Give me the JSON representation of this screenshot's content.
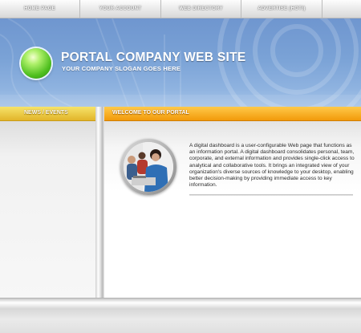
{
  "nav": {
    "items": [
      {
        "label": "HOME PAGE"
      },
      {
        "label": "YOUR ACCOUNT"
      },
      {
        "label": "WEB DIRECTORY"
      },
      {
        "label": "ADVERTISE (HOT!)"
      }
    ]
  },
  "header": {
    "title": "PORTAL COMPANY WEB SITE",
    "slogan": "YOUR COMPANY SLOGAN GOES HERE"
  },
  "sidebar": {
    "heading": "NEWS / EVENTS"
  },
  "main": {
    "heading": "WELCOME TO OUR PORTAL",
    "intro": "A digital dashboard is a user-configurable Web page that functions as an information portal. A digital dashboard consolidates personal, team, corporate, and external information and provides single-click access to analytical and collaborative tools. It brings an integrated view of your organization's diverse sources of knowledge to your desktop, enabling better decision-making by providing immediate access to key information."
  },
  "colors": {
    "header_blue": "#7aa2d6",
    "yellow_bar": "#f0c83a",
    "orange_bar": "#f5a318",
    "orb_green": "#4fbf1f"
  }
}
